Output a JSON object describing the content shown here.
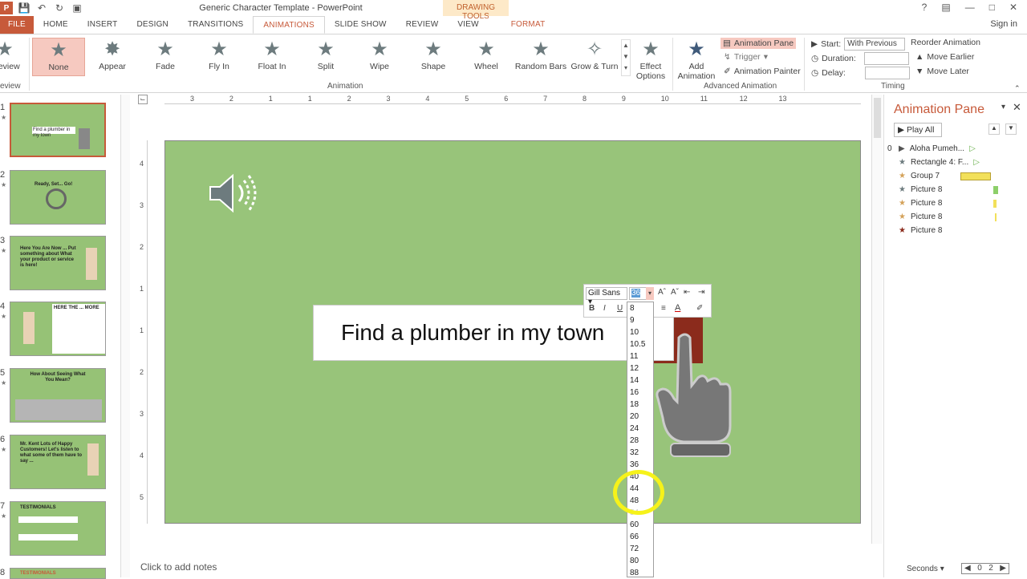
{
  "window": {
    "title": "Generic Character Template - PowerPoint",
    "context_tab": "DRAWING TOOLS",
    "help": "?"
  },
  "tabs": [
    "FILE",
    "HOME",
    "INSERT",
    "DESIGN",
    "TRANSITIONS",
    "ANIMATIONS",
    "SLIDE SHOW",
    "REVIEW",
    "VIEW",
    "FORMAT"
  ],
  "active_tab": "ANIMATIONS",
  "signin": "Sign in",
  "ribbon": {
    "preview": {
      "label": "Preview",
      "group": "Preview"
    },
    "animations": [
      "None",
      "Appear",
      "Fade",
      "Fly In",
      "Float In",
      "Split",
      "Wipe",
      "Shape",
      "Wheel",
      "Random Bars",
      "Grow & Turn"
    ],
    "selected_animation": "None",
    "effect_options": [
      "Effect",
      "Options"
    ],
    "group_animation": "Animation",
    "add_animation": [
      "Add",
      "Animation"
    ],
    "animation_pane_btn": "Animation Pane",
    "trigger": "Trigger",
    "animation_painter": "Animation Painter",
    "group_advanced": "Advanced Animation",
    "start_label": "Start:",
    "start_value": "With Previous",
    "duration_label": "Duration:",
    "delay_label": "Delay:",
    "reorder": "Reorder Animation",
    "move_earlier": "Move Earlier",
    "move_later": "Move Later",
    "group_timing": "Timing"
  },
  "thumbnails": [
    {
      "num": "1",
      "text": "Find a plumber in my town"
    },
    {
      "num": "2",
      "text": "Ready, Set... Go!"
    },
    {
      "num": "3",
      "text": "Here You Are Now ... Put something about What your product or service is here!"
    },
    {
      "num": "4",
      "text": "HERE THE ... MORE"
    },
    {
      "num": "5",
      "text": "How About Seeing What You Mean?"
    },
    {
      "num": "6",
      "text": "Mr. Kent Lots of Happy Customers! Let's listen to what some of them have to say ..."
    },
    {
      "num": "7",
      "text": "TESTIMONIALS"
    },
    {
      "num": "8",
      "text": "TESTIMONIALS"
    }
  ],
  "ruler_top": [
    "3",
    "2",
    "1",
    "1",
    "2",
    "3",
    "4",
    "5",
    "6",
    "7",
    "8",
    "9",
    "10",
    "11",
    "12",
    "13"
  ],
  "ruler_left": [
    "4",
    "3",
    "2",
    "1",
    "1",
    "2",
    "3",
    "4",
    "5"
  ],
  "slide": {
    "textbox": "Find a plumber in my town"
  },
  "mini_toolbar": {
    "font": "Gill Sans",
    "size": "36"
  },
  "font_sizes": [
    "8",
    "9",
    "10",
    "10.5",
    "11",
    "12",
    "14",
    "16",
    "18",
    "20",
    "24",
    "28",
    "32",
    "36",
    "40",
    "44",
    "48",
    "54",
    "60",
    "66",
    "72",
    "80",
    "88"
  ],
  "notes": "Click to add notes",
  "anim_pane": {
    "title": "Animation Pane",
    "play_all": "Play All",
    "items": [
      {
        "idx": "0",
        "name": "Aloha Pumeh...",
        "color": "#666"
      },
      {
        "idx": "",
        "name": "Rectangle 4: F...",
        "color": "#6d7b7e"
      },
      {
        "idx": "",
        "name": "Group 7",
        "color": "#d4a25a"
      },
      {
        "idx": "",
        "name": "Picture 8",
        "color": "#6d7b7e"
      },
      {
        "idx": "",
        "name": "Picture 8",
        "color": "#d4a25a"
      },
      {
        "idx": "",
        "name": "Picture 8",
        "color": "#d4a25a"
      },
      {
        "idx": "",
        "name": "Picture 8",
        "color": "#8b2b1c"
      }
    ],
    "seconds": "Seconds",
    "zoom_from": "0",
    "zoom_to": "2"
  }
}
